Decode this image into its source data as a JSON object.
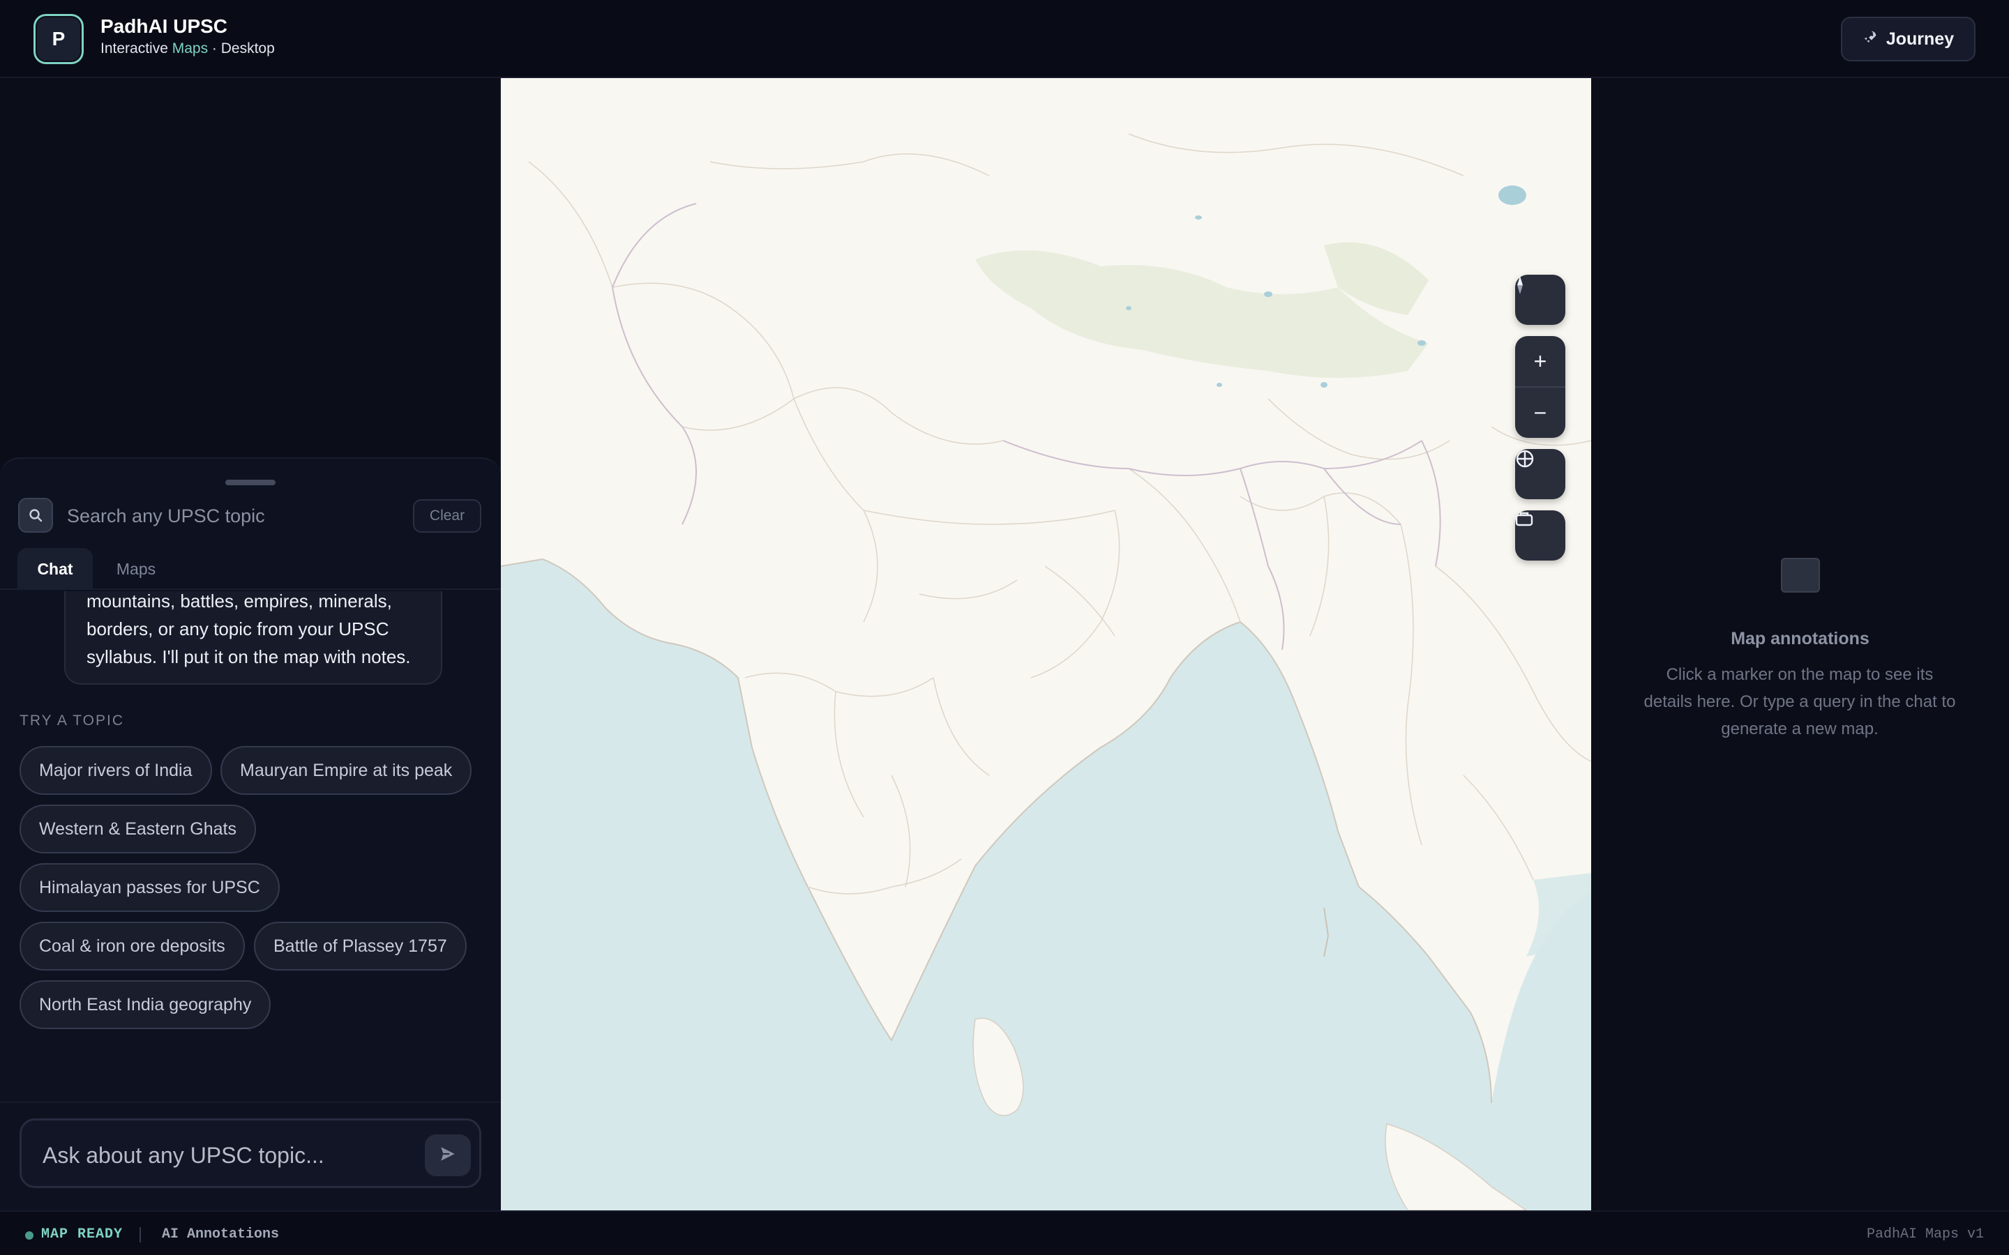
{
  "header": {
    "logo_letter": "P",
    "title": "PadhAI UPSC",
    "subtitle_prefix": "Interactive ",
    "subtitle_accent": "Maps",
    "subtitle_suffix": " · Desktop",
    "journey_label": "Journey",
    "journey_icon": "rocket-icon"
  },
  "search": {
    "placeholder": "Search any UPSC topic",
    "clear_label": "Clear"
  },
  "tabs": [
    {
      "label": "Chat",
      "active": true
    },
    {
      "label": "Maps",
      "active": false
    }
  ],
  "chat": {
    "assistant_message_visible": "mountains, battles, empires, minerals, borders, or any topic from your UPSC syllabus. I'll put it on the map with notes.",
    "try_label": "TRY A TOPIC",
    "topics": [
      "Major rivers of India",
      "Mauryan Empire at its peak",
      "Western & Eastern Ghats",
      "Himalayan passes for UPSC",
      "Coal & iron ore deposits",
      "Battle of Plassey 1757",
      "North East India geography"
    ],
    "input_placeholder": "Ask about any UPSC topic..."
  },
  "map_controls": {
    "compass": "compass-icon",
    "zoom_in": "+",
    "zoom_out": "−",
    "locate": "crosshair-icon",
    "layers": "layers-icon"
  },
  "annotations": {
    "title": "Map annotations",
    "text": "Click a marker on the map to see its details here. Or type a query in the chat to generate a new map."
  },
  "footer": {
    "status": "MAP READY",
    "mode": "AI Annotations",
    "version": "PadhAI Maps v1"
  },
  "colors": {
    "accent": "#7fd3c3",
    "background": "#0b0d18",
    "land": "#f9f7f1",
    "water": "#d6e8ea"
  }
}
